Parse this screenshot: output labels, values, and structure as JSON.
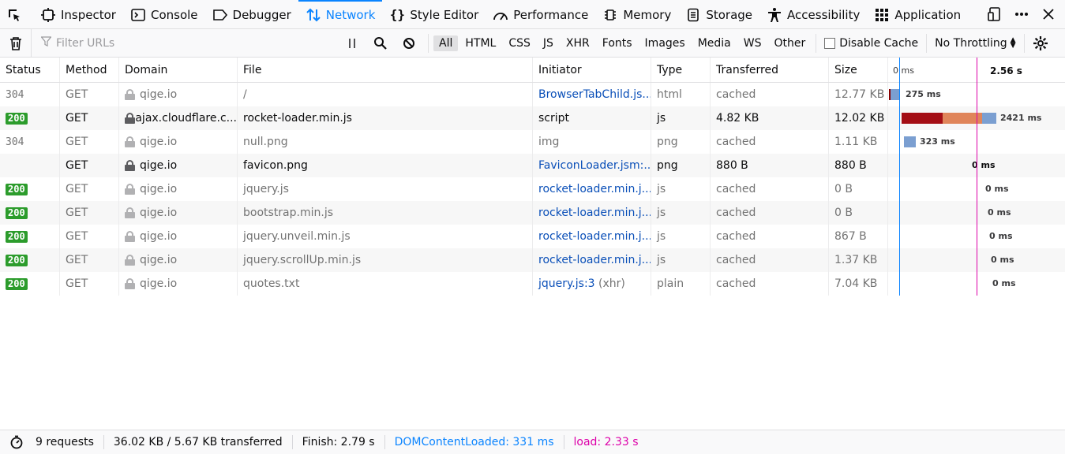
{
  "tabs": [
    {
      "label": "Inspector",
      "icon": "inspector-icon"
    },
    {
      "label": "Console",
      "icon": "console-icon"
    },
    {
      "label": "Debugger",
      "icon": "debugger-icon"
    },
    {
      "label": "Network",
      "icon": "network-icon",
      "active": true
    },
    {
      "label": "Style Editor",
      "icon": "style-editor-icon"
    },
    {
      "label": "Performance",
      "icon": "performance-icon"
    },
    {
      "label": "Memory",
      "icon": "memory-icon"
    },
    {
      "label": "Storage",
      "icon": "storage-icon"
    },
    {
      "label": "Accessibility",
      "icon": "accessibility-icon"
    },
    {
      "label": "Application",
      "icon": "application-icon"
    }
  ],
  "toolbar": {
    "filter_placeholder": "Filter URLs",
    "types": [
      "All",
      "HTML",
      "CSS",
      "JS",
      "XHR",
      "Fonts",
      "Images",
      "Media",
      "WS",
      "Other"
    ],
    "selected_type": "All",
    "disable_cache_label": "Disable Cache",
    "throttling_label": "No Throttling"
  },
  "columns": {
    "status": "Status",
    "method": "Method",
    "domain": "Domain",
    "file": "File",
    "initiator": "Initiator",
    "type": "Type",
    "transferred": "Transferred",
    "size": "Size",
    "wf_start": "0 ms",
    "wf_end": "2.56 s"
  },
  "requests": [
    {
      "status": "304",
      "method": "GET",
      "domain": "qige.io",
      "file": "/",
      "initiator": "BrowserTabChild.js...",
      "initiator_link": true,
      "type": "html",
      "transferred": "cached",
      "size": "12.77 KB",
      "time": "275 ms",
      "dim": true
    },
    {
      "status": "200",
      "method": "GET",
      "domain": "ajax.cloudflare.c...",
      "file": "rocket-loader.min.js",
      "initiator": "script",
      "initiator_link": false,
      "type": "js",
      "transferred": "4.82 KB",
      "size": "12.02 KB",
      "time": "2421 ms",
      "dim": false
    },
    {
      "status": "304",
      "method": "GET",
      "domain": "qige.io",
      "file": "null.png",
      "initiator": "img",
      "initiator_link": false,
      "type": "png",
      "transferred": "cached",
      "size": "1.11 KB",
      "time": "323 ms",
      "dim": true
    },
    {
      "status": "",
      "method": "GET",
      "domain": "qige.io",
      "file": "favicon.png",
      "initiator": "FaviconLoader.jsm:...",
      "initiator_link": true,
      "type": "png",
      "transferred": "880 B",
      "size": "880 B",
      "time": "0 ms",
      "dim": false
    },
    {
      "status": "200",
      "method": "GET",
      "domain": "qige.io",
      "file": "jquery.js",
      "initiator": "rocket-loader.min.j...",
      "initiator_link": true,
      "type": "js",
      "transferred": "cached",
      "size": "0 B",
      "time": "0 ms",
      "dim": true
    },
    {
      "status": "200",
      "method": "GET",
      "domain": "qige.io",
      "file": "bootstrap.min.js",
      "initiator": "rocket-loader.min.j...",
      "initiator_link": true,
      "type": "js",
      "transferred": "cached",
      "size": "0 B",
      "time": "0 ms",
      "dim": true
    },
    {
      "status": "200",
      "method": "GET",
      "domain": "qige.io",
      "file": "jquery.unveil.min.js",
      "initiator": "rocket-loader.min.j...",
      "initiator_link": true,
      "type": "js",
      "transferred": "cached",
      "size": "867 B",
      "time": "0 ms",
      "dim": true
    },
    {
      "status": "200",
      "method": "GET",
      "domain": "qige.io",
      "file": "jquery.scrollUp.min.js",
      "initiator": "rocket-loader.min.j...",
      "initiator_link": true,
      "type": "js",
      "transferred": "cached",
      "size": "1.37 KB",
      "time": "0 ms",
      "dim": true
    },
    {
      "status": "200",
      "method": "GET",
      "domain": "qige.io",
      "file": "quotes.txt",
      "initiator": "jquery.js:3",
      "initiator_suffix": " (xhr)",
      "initiator_link": true,
      "type": "plain",
      "transferred": "cached",
      "size": "7.04 KB",
      "time": "0 ms",
      "dim": true
    }
  ],
  "statusbar": {
    "requests": "9 requests",
    "size": "36.02 KB / 5.67 KB transferred",
    "finish": "Finish: 2.79 s",
    "dcl": "DOMContentLoaded: 331 ms",
    "load": "load: 2.33 s"
  },
  "colors": {
    "accent": "#0a84ff",
    "status_ok": "#2c9c2c",
    "dcl": "#0a84ff",
    "load": "#dd00a9"
  }
}
